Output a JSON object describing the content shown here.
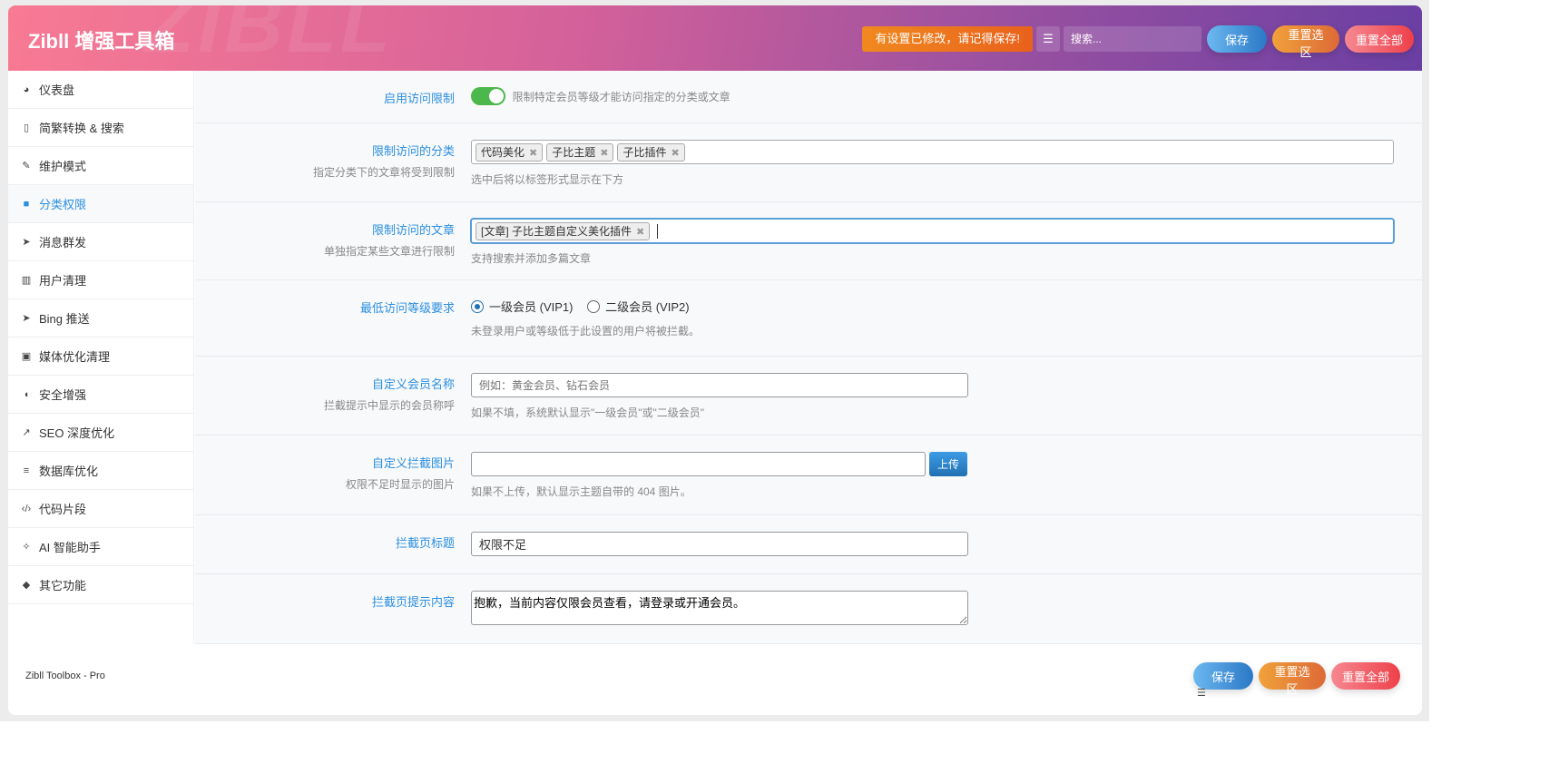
{
  "header": {
    "title": "Zibll 增强工具箱",
    "watermark": "ZIBLL",
    "notice": "有设置已修改，请记得保存!",
    "search_placeholder": "搜索...",
    "save": "保存",
    "reset_section": "重置选区",
    "reset_all": "重置全部"
  },
  "sidebar": {
    "items": [
      {
        "label": "仪表盘",
        "icon": "dashboard-icon",
        "glyph": "◕"
      },
      {
        "label": "简繁转换 & 搜索",
        "icon": "translate-icon",
        "glyph": "▯"
      },
      {
        "label": "维护模式",
        "icon": "wrench-icon",
        "glyph": "✎"
      },
      {
        "label": "分类权限",
        "icon": "lock-icon",
        "glyph": "■"
      },
      {
        "label": "消息群发",
        "icon": "send-icon",
        "glyph": "➤"
      },
      {
        "label": "用户清理",
        "icon": "trash-icon",
        "glyph": "▥"
      },
      {
        "label": "Bing 推送",
        "icon": "send-icon",
        "glyph": "➤"
      },
      {
        "label": "媒体优化清理",
        "icon": "image-icon",
        "glyph": "▣"
      },
      {
        "label": "安全增强",
        "icon": "shield-icon",
        "glyph": "◖"
      },
      {
        "label": "SEO 深度优化",
        "icon": "chart-line-icon",
        "glyph": "↗"
      },
      {
        "label": "数据库优化",
        "icon": "database-icon",
        "glyph": "≡"
      },
      {
        "label": "代码片段",
        "icon": "code-icon",
        "glyph": "‹/›"
      },
      {
        "label": "AI 智能助手",
        "icon": "magic-wand-icon",
        "glyph": "✧"
      },
      {
        "label": "其它功能",
        "icon": "cubes-icon",
        "glyph": "◆"
      }
    ],
    "active": 3
  },
  "fields": {
    "enable": {
      "label": "启用访问限制",
      "desc": "限制特定会员等级才能访问指定的分类或文章",
      "value": true
    },
    "categories": {
      "label": "限制访问的分类",
      "sub": "指定分类下的文章将受到限制",
      "tags": [
        "代码美化",
        "子比主题",
        "子比插件"
      ],
      "help": "选中后将以标签形式显示在下方"
    },
    "posts": {
      "label": "限制访问的文章",
      "sub": "单独指定某些文章进行限制",
      "tags": [
        "[文章] 子比主题自定义美化插件"
      ],
      "help": "支持搜索并添加多篇文章"
    },
    "level": {
      "label": "最低访问等级要求",
      "options": [
        "一级会员 (VIP1)",
        "二级会员 (VIP2)"
      ],
      "selected": 0,
      "help": "未登录用户或等级低于此设置的用户将被拦截。"
    },
    "member_name": {
      "label": "自定义会员名称",
      "sub": "拦截提示中显示的会员称呼",
      "placeholder": "例如：黄金会员、钻石会员",
      "help": "如果不填，系统默认显示\"一级会员\"或\"二级会员\""
    },
    "image": {
      "label": "自定义拦截图片",
      "sub": "权限不足时显示的图片",
      "value": "",
      "upload": "上传",
      "help": "如果不上传，默认显示主题自带的 404 图片。"
    },
    "page_title": {
      "label": "拦截页标题",
      "value": "权限不足"
    },
    "page_content": {
      "label": "拦截页提示内容",
      "value": "抱歉，当前内容仅限会员查看，请登录或开通会员。"
    }
  },
  "footer": {
    "text": "Zibll Toolbox - Pro",
    "save": "保存",
    "reset_section": "重置选区",
    "reset_all": "重置全部"
  }
}
